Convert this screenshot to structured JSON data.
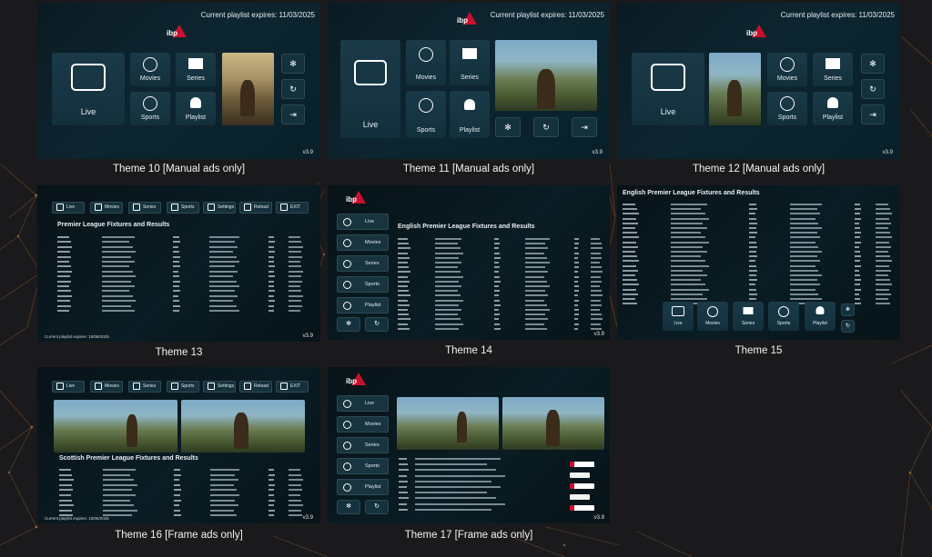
{
  "themes": [
    {
      "label": "Theme 10 [Manual ads only]"
    },
    {
      "label": "Theme 11 [Manual ads only]"
    },
    {
      "label": "Theme 12 [Manual ads only]"
    },
    {
      "label": "Theme 13"
    },
    {
      "label": "Theme 14"
    },
    {
      "label": "Theme 15"
    },
    {
      "label": "Theme 16 [Frame ads only]"
    },
    {
      "label": "Theme 17 [Frame ads only]"
    }
  ],
  "common": {
    "expires": "Current playlist expires: 11/03/2025",
    "version": "v3.9",
    "logo": "ibp",
    "menu": {
      "live": "Live",
      "movies": "Movies",
      "series": "Series",
      "sports": "Sports",
      "playlist": "Playlist",
      "settings": "Settings",
      "reload": "Reload",
      "exit": "EXIT"
    }
  },
  "fixtures": {
    "premier_short": "Premier League Fixtures and Results",
    "english_premier": "English Premier League Fixtures and Results",
    "scottish_premier": "Scottish Premier League Fixtures and Results",
    "results": "Results",
    "small_expires": "Current playlist expires: 18/06/2025"
  },
  "colors": {
    "accent": "#c8102e",
    "tile": "#1b3a48",
    "background": "#1a1a1c",
    "network": "#c87a3a"
  }
}
